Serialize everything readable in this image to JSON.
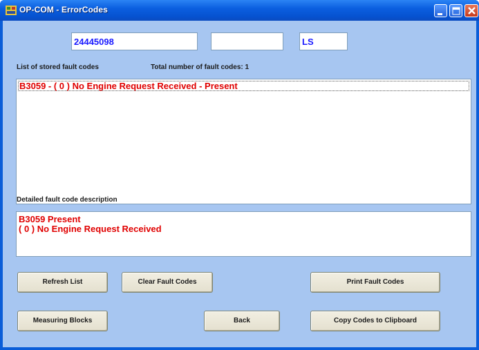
{
  "window": {
    "title": "OP-COM - ErrorCodes",
    "icon": "app-icon",
    "controls": [
      "minimize-icon",
      "maximize-icon",
      "close-icon"
    ]
  },
  "header": {
    "field1_value": "24445098",
    "field2_value": "",
    "field3_value": "LS"
  },
  "fault_list": {
    "label": "List of stored fault codes",
    "total_label": "Total number of fault codes: 1",
    "items": [
      "B3059 - ( 0 )  No Engine Request Received - Present"
    ]
  },
  "detail": {
    "label": "Detailed fault code description",
    "line1": "B3059  Present",
    "line2": "( 0 )  No Engine Request Received"
  },
  "buttons": {
    "refresh": "Refresh List",
    "clear": "Clear Fault Codes",
    "print": "Print Fault Codes",
    "measuring": "Measuring Blocks",
    "back": "Back",
    "copy": "Copy Codes to Clipboard"
  },
  "colors": {
    "client_bg": "#A7C6F1",
    "titlebar": "#0B5FE0",
    "fault_text": "#e00000",
    "field_text": "#1a1aff"
  }
}
